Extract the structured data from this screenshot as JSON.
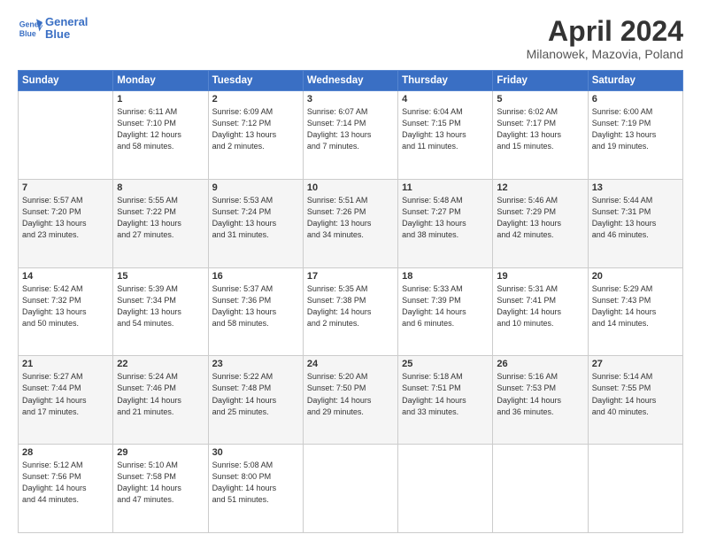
{
  "logo": {
    "line1": "General",
    "line2": "Blue"
  },
  "title": "April 2024",
  "subtitle": "Milanowek, Mazovia, Poland",
  "weekdays": [
    "Sunday",
    "Monday",
    "Tuesday",
    "Wednesday",
    "Thursday",
    "Friday",
    "Saturday"
  ],
  "weeks": [
    [
      {
        "day": "",
        "detail": ""
      },
      {
        "day": "1",
        "detail": "Sunrise: 6:11 AM\nSunset: 7:10 PM\nDaylight: 12 hours\nand 58 minutes."
      },
      {
        "day": "2",
        "detail": "Sunrise: 6:09 AM\nSunset: 7:12 PM\nDaylight: 13 hours\nand 2 minutes."
      },
      {
        "day": "3",
        "detail": "Sunrise: 6:07 AM\nSunset: 7:14 PM\nDaylight: 13 hours\nand 7 minutes."
      },
      {
        "day": "4",
        "detail": "Sunrise: 6:04 AM\nSunset: 7:15 PM\nDaylight: 13 hours\nand 11 minutes."
      },
      {
        "day": "5",
        "detail": "Sunrise: 6:02 AM\nSunset: 7:17 PM\nDaylight: 13 hours\nand 15 minutes."
      },
      {
        "day": "6",
        "detail": "Sunrise: 6:00 AM\nSunset: 7:19 PM\nDaylight: 13 hours\nand 19 minutes."
      }
    ],
    [
      {
        "day": "7",
        "detail": "Sunrise: 5:57 AM\nSunset: 7:20 PM\nDaylight: 13 hours\nand 23 minutes."
      },
      {
        "day": "8",
        "detail": "Sunrise: 5:55 AM\nSunset: 7:22 PM\nDaylight: 13 hours\nand 27 minutes."
      },
      {
        "day": "9",
        "detail": "Sunrise: 5:53 AM\nSunset: 7:24 PM\nDaylight: 13 hours\nand 31 minutes."
      },
      {
        "day": "10",
        "detail": "Sunrise: 5:51 AM\nSunset: 7:26 PM\nDaylight: 13 hours\nand 34 minutes."
      },
      {
        "day": "11",
        "detail": "Sunrise: 5:48 AM\nSunset: 7:27 PM\nDaylight: 13 hours\nand 38 minutes."
      },
      {
        "day": "12",
        "detail": "Sunrise: 5:46 AM\nSunset: 7:29 PM\nDaylight: 13 hours\nand 42 minutes."
      },
      {
        "day": "13",
        "detail": "Sunrise: 5:44 AM\nSunset: 7:31 PM\nDaylight: 13 hours\nand 46 minutes."
      }
    ],
    [
      {
        "day": "14",
        "detail": "Sunrise: 5:42 AM\nSunset: 7:32 PM\nDaylight: 13 hours\nand 50 minutes."
      },
      {
        "day": "15",
        "detail": "Sunrise: 5:39 AM\nSunset: 7:34 PM\nDaylight: 13 hours\nand 54 minutes."
      },
      {
        "day": "16",
        "detail": "Sunrise: 5:37 AM\nSunset: 7:36 PM\nDaylight: 13 hours\nand 58 minutes."
      },
      {
        "day": "17",
        "detail": "Sunrise: 5:35 AM\nSunset: 7:38 PM\nDaylight: 14 hours\nand 2 minutes."
      },
      {
        "day": "18",
        "detail": "Sunrise: 5:33 AM\nSunset: 7:39 PM\nDaylight: 14 hours\nand 6 minutes."
      },
      {
        "day": "19",
        "detail": "Sunrise: 5:31 AM\nSunset: 7:41 PM\nDaylight: 14 hours\nand 10 minutes."
      },
      {
        "day": "20",
        "detail": "Sunrise: 5:29 AM\nSunset: 7:43 PM\nDaylight: 14 hours\nand 14 minutes."
      }
    ],
    [
      {
        "day": "21",
        "detail": "Sunrise: 5:27 AM\nSunset: 7:44 PM\nDaylight: 14 hours\nand 17 minutes."
      },
      {
        "day": "22",
        "detail": "Sunrise: 5:24 AM\nSunset: 7:46 PM\nDaylight: 14 hours\nand 21 minutes."
      },
      {
        "day": "23",
        "detail": "Sunrise: 5:22 AM\nSunset: 7:48 PM\nDaylight: 14 hours\nand 25 minutes."
      },
      {
        "day": "24",
        "detail": "Sunrise: 5:20 AM\nSunset: 7:50 PM\nDaylight: 14 hours\nand 29 minutes."
      },
      {
        "day": "25",
        "detail": "Sunrise: 5:18 AM\nSunset: 7:51 PM\nDaylight: 14 hours\nand 33 minutes."
      },
      {
        "day": "26",
        "detail": "Sunrise: 5:16 AM\nSunset: 7:53 PM\nDaylight: 14 hours\nand 36 minutes."
      },
      {
        "day": "27",
        "detail": "Sunrise: 5:14 AM\nSunset: 7:55 PM\nDaylight: 14 hours\nand 40 minutes."
      }
    ],
    [
      {
        "day": "28",
        "detail": "Sunrise: 5:12 AM\nSunset: 7:56 PM\nDaylight: 14 hours\nand 44 minutes."
      },
      {
        "day": "29",
        "detail": "Sunrise: 5:10 AM\nSunset: 7:58 PM\nDaylight: 14 hours\nand 47 minutes."
      },
      {
        "day": "30",
        "detail": "Sunrise: 5:08 AM\nSunset: 8:00 PM\nDaylight: 14 hours\nand 51 minutes."
      },
      {
        "day": "",
        "detail": ""
      },
      {
        "day": "",
        "detail": ""
      },
      {
        "day": "",
        "detail": ""
      },
      {
        "day": "",
        "detail": ""
      }
    ]
  ]
}
